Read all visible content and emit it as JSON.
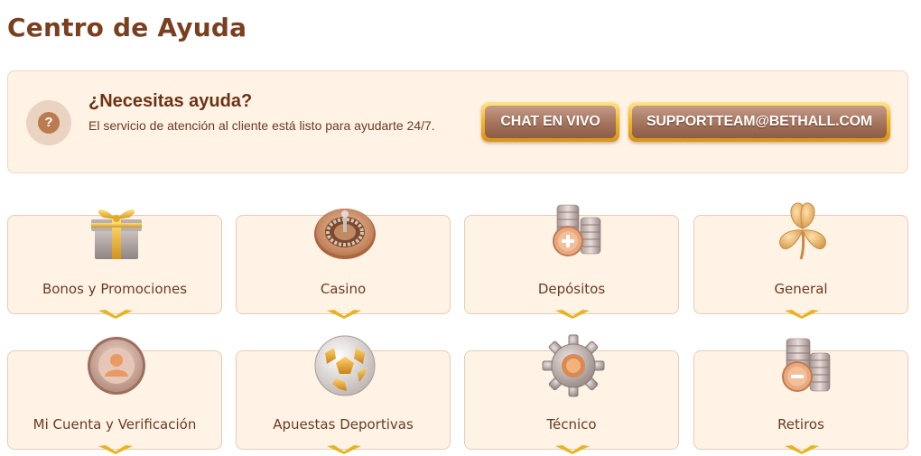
{
  "page": {
    "title": "Centro de Ayuda"
  },
  "help": {
    "heading": "¿Necesitas ayuda?",
    "description": "El servicio de atención al cliente está listo para ayudarte 24/7.",
    "icon": "question-icon",
    "icon_glyph": "?",
    "chat_label": "CHAT EN VIVO",
    "email_label": "SUPPORTTEAM@BETHALL.COM"
  },
  "categories": [
    {
      "label": "Bonos y Promociones",
      "icon": "gift-icon"
    },
    {
      "label": "Casino",
      "icon": "roulette-icon"
    },
    {
      "label": "Depósitos",
      "icon": "coins-plus-icon"
    },
    {
      "label": "General",
      "icon": "clover-icon"
    },
    {
      "label": "Mi Cuenta y Verificación",
      "icon": "user-icon"
    },
    {
      "label": "Apuestas Deportivas",
      "icon": "soccer-ball-icon"
    },
    {
      "label": "Técnico",
      "icon": "gear-icon"
    },
    {
      "label": "Retiros",
      "icon": "coins-minus-icon"
    }
  ],
  "colors": {
    "title": "#7a3f1f",
    "card_bg": "#fff3e6",
    "gold": "#f2b928",
    "button_brown": "#a4735c"
  }
}
